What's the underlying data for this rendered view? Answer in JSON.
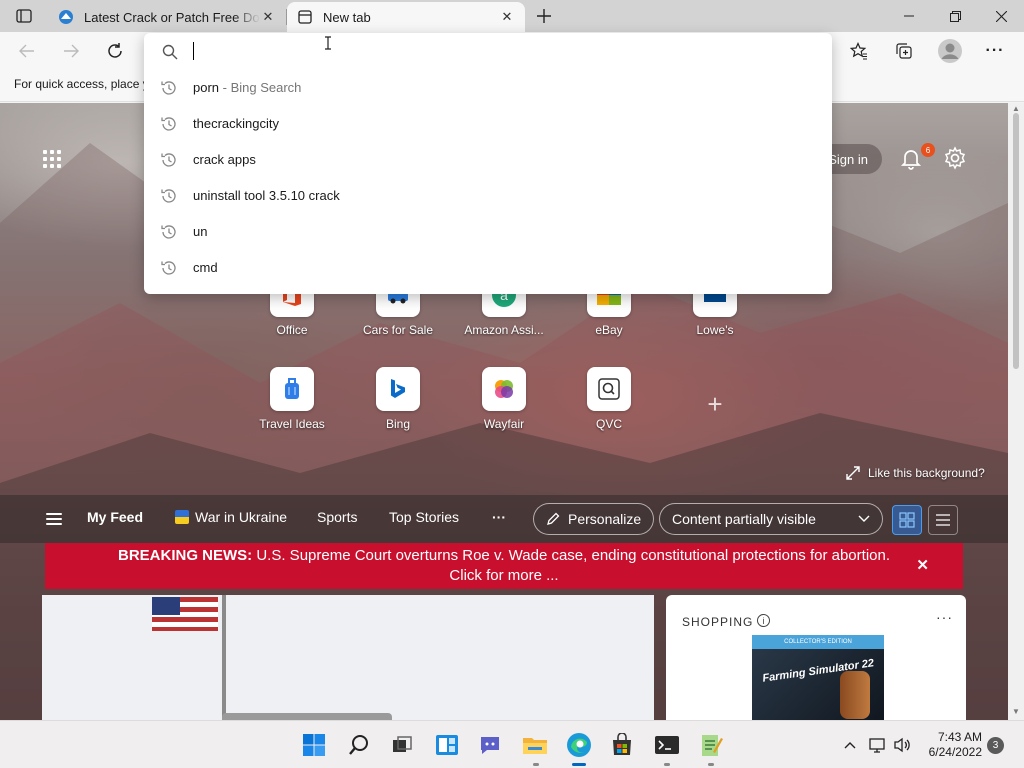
{
  "tabs": [
    {
      "title": "Latest Crack or Patch Free Download",
      "active": false
    },
    {
      "title": "New tab",
      "active": true
    }
  ],
  "favorites_bar": {
    "text": "For quick access, place y"
  },
  "omnibox": {
    "value": "",
    "suggestions": [
      {
        "text": "porn",
        "suffix": " - Bing Search"
      },
      {
        "text": "thecrackingcity",
        "suffix": ""
      },
      {
        "text": "crack apps",
        "suffix": ""
      },
      {
        "text": "uninstall tool 3.5.10 crack",
        "suffix": ""
      },
      {
        "text": "un",
        "suffix": ""
      },
      {
        "text": "cmd",
        "suffix": ""
      }
    ]
  },
  "newtab": {
    "sign_in": "Sign in",
    "notification_count": "6",
    "quick_links": [
      {
        "label": "Office",
        "icon": "office-icon"
      },
      {
        "label": "Cars for Sale",
        "icon": "car-icon"
      },
      {
        "label": "Amazon Assi...",
        "icon": "amazon-icon"
      },
      {
        "label": "eBay",
        "icon": "ebay-icon"
      },
      {
        "label": "Lowe's",
        "icon": "lowes-icon"
      },
      {
        "label": "Travel Ideas",
        "icon": "luggage-icon"
      },
      {
        "label": "Bing",
        "icon": "bing-icon"
      },
      {
        "label": "Wayfair",
        "icon": "wayfair-icon"
      },
      {
        "label": "QVC",
        "icon": "qvc-icon"
      }
    ],
    "like_background": "Like this background?",
    "feed": {
      "items": [
        "My Feed",
        "War in Ukraine",
        "Sports",
        "Top Stories",
        "···"
      ],
      "personalize": "Personalize",
      "content_visibility": "Content partially visible"
    },
    "breaking": {
      "label": "BREAKING NEWS:",
      "headline": "U.S. Supreme Court overturns Roe v. Wade case, ending constitutional protections for abortion.",
      "cta": "Click for more ..."
    },
    "shopping": {
      "title": "SHOPPING",
      "more": "···",
      "product_band": "COLLECTOR'S EDITION",
      "product_title": "Farming Simulator 22"
    }
  },
  "taskbar": {
    "time": "7:43 AM",
    "date": "6/24/2022",
    "notifications": "3"
  },
  "colors": {
    "breaking_bg": "#c8102e",
    "accent": "#0067c0",
    "badge": "#e8501e"
  }
}
